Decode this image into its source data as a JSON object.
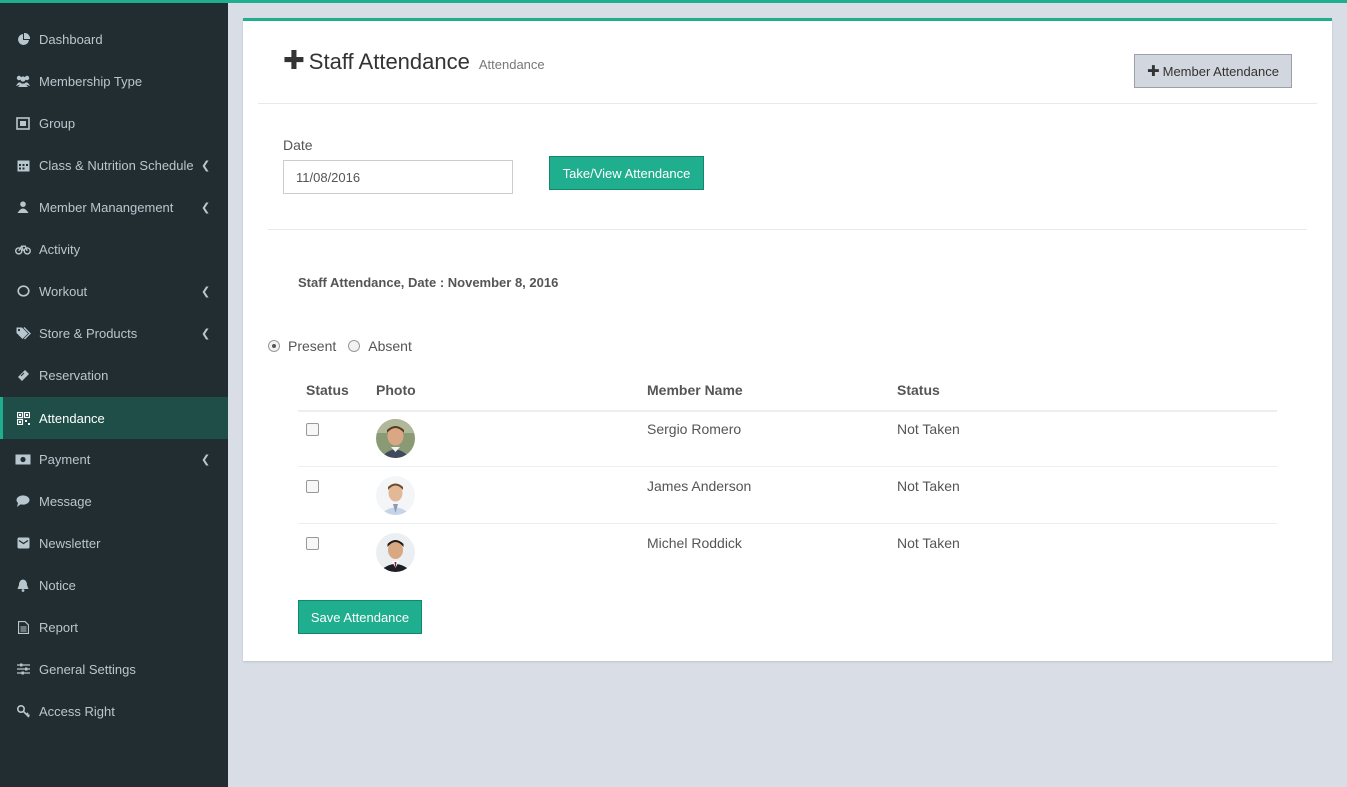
{
  "sidebar": {
    "items": [
      {
        "label": "Dashboard",
        "icon": "pie-chart-icon",
        "has_submenu": false
      },
      {
        "label": "Membership Type",
        "icon": "users-icon",
        "has_submenu": false
      },
      {
        "label": "Group",
        "icon": "group-icon",
        "has_submenu": false
      },
      {
        "label": "Class & Nutrition Schedule",
        "icon": "calendar-icon",
        "has_submenu": true
      },
      {
        "label": "Member Manangement",
        "icon": "user-icon",
        "has_submenu": true
      },
      {
        "label": "Activity",
        "icon": "bicycle-icon",
        "has_submenu": false
      },
      {
        "label": "Workout",
        "icon": "lemon-icon",
        "has_submenu": true
      },
      {
        "label": "Store & Products",
        "icon": "tags-icon",
        "has_submenu": true
      },
      {
        "label": "Reservation",
        "icon": "ticket-icon",
        "has_submenu": false
      },
      {
        "label": "Attendance",
        "icon": "qrcode-icon",
        "has_submenu": false,
        "active": true
      },
      {
        "label": "Payment",
        "icon": "money-icon",
        "has_submenu": true
      },
      {
        "label": "Message",
        "icon": "comment-icon",
        "has_submenu": false
      },
      {
        "label": "Newsletter",
        "icon": "envelope-icon",
        "has_submenu": false
      },
      {
        "label": "Notice",
        "icon": "bell-icon",
        "has_submenu": false
      },
      {
        "label": "Report",
        "icon": "file-text-icon",
        "has_submenu": false
      },
      {
        "label": "General Settings",
        "icon": "sliders-icon",
        "has_submenu": false
      },
      {
        "label": "Access Right",
        "icon": "key-icon",
        "has_submenu": false
      }
    ]
  },
  "header": {
    "title": "Staff Attendance",
    "subtitle": "Attendance",
    "member_attendance_label": "Member Attendance"
  },
  "form": {
    "date_label": "Date",
    "date_value": "11/08/2016",
    "take_view_label": "Take/View Attendance"
  },
  "attendance": {
    "heading": "Staff Attendance, Date : November 8, 2016",
    "present_label": "Present",
    "absent_label": "Absent",
    "selected": "Present",
    "columns": [
      "Status",
      "Photo",
      "Member Name",
      "Status"
    ],
    "rows": [
      {
        "name": "Sergio Romero",
        "status": "Not Taken",
        "checked": false
      },
      {
        "name": "James Anderson",
        "status": "Not Taken",
        "checked": false
      },
      {
        "name": "Michel Roddick",
        "status": "Not Taken",
        "checked": false
      }
    ],
    "save_label": "Save Attendance"
  },
  "colors": {
    "accent": "#1fae8e",
    "sidebar_bg": "#222d32",
    "sidebar_active": "#1e4e47",
    "page_bg": "#d9dee6"
  }
}
